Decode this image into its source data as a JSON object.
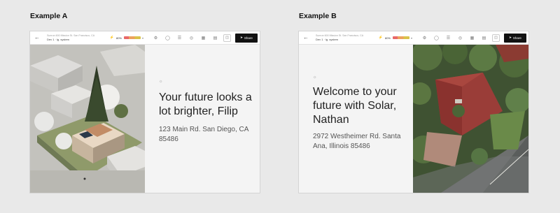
{
  "examples": [
    {
      "label": "Example A",
      "topbar": {
        "address": "Sunrun 600 Mission St. San Francisco, CA",
        "system": "Dev 1 · lg. system",
        "percent": "80%",
        "share": "Share"
      },
      "headline": "Your future looks a lot brighter, Filip",
      "address": "123 Main Rd. San Diego, CA 85486"
    },
    {
      "label": "Example B",
      "topbar": {
        "address": "Sunrun 600 Mission St. San Francisco, CA",
        "system": "Dev 1 · lg. system",
        "percent": "80%",
        "share": "Share"
      },
      "headline": "Welcome to your future with Solar, Nathan",
      "address": "2972 Westheimer Rd. Santa Ana, Illinois 85486"
    }
  ],
  "icons": {
    "back": "arrow-left-icon",
    "bolt": "bolt-icon",
    "share": "send-icon",
    "sun": "sun-icon"
  },
  "colors": {
    "share_button": "#111111",
    "meter": [
      "#e86868",
      "#eda25c",
      "#d9c24a"
    ]
  }
}
